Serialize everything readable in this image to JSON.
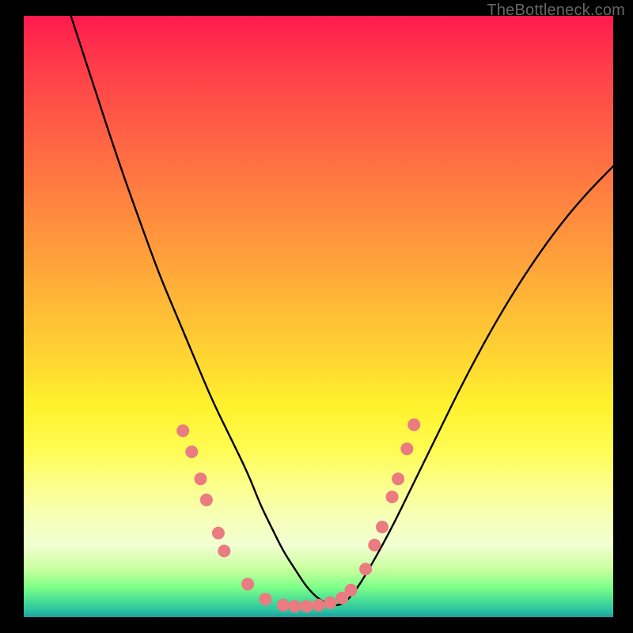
{
  "watermark": "TheBottleneck.com",
  "chart_data": {
    "type": "line",
    "title": "",
    "xlabel": "",
    "ylabel": "",
    "xlim": [
      0,
      100
    ],
    "ylim": [
      0,
      100
    ],
    "legend": false,
    "grid": false,
    "series": [
      {
        "name": "curve",
        "color": "#000000",
        "x": [
          8,
          12,
          16,
          20,
          23,
          26,
          29,
          32,
          35,
          38,
          40,
          42,
          44,
          46,
          48,
          50,
          52,
          54,
          56,
          58,
          62,
          66,
          70,
          75,
          80,
          85,
          90,
          95,
          100
        ],
        "y": [
          100,
          88,
          76,
          65,
          57,
          50,
          43,
          36,
          30,
          24,
          19,
          15,
          11,
          8,
          5,
          3,
          2,
          2,
          4,
          7,
          14,
          22,
          30,
          40,
          49,
          57,
          64,
          70,
          75
        ]
      }
    ],
    "markers": {
      "name": "dots",
      "color": "#e97b81",
      "radius": 8,
      "points": [
        {
          "x": 27,
          "y": 31
        },
        {
          "x": 28.5,
          "y": 27.5
        },
        {
          "x": 30,
          "y": 23
        },
        {
          "x": 31,
          "y": 19.5
        },
        {
          "x": 33,
          "y": 14
        },
        {
          "x": 34,
          "y": 11
        },
        {
          "x": 38,
          "y": 5.5
        },
        {
          "x": 41,
          "y": 3
        },
        {
          "x": 44,
          "y": 2
        },
        {
          "x": 46,
          "y": 1.8
        },
        {
          "x": 48,
          "y": 1.8
        },
        {
          "x": 50,
          "y": 2
        },
        {
          "x": 52,
          "y": 2.4
        },
        {
          "x": 54,
          "y": 3.2
        },
        {
          "x": 55.5,
          "y": 4.5
        },
        {
          "x": 58,
          "y": 8
        },
        {
          "x": 59.5,
          "y": 12
        },
        {
          "x": 60.8,
          "y": 15
        },
        {
          "x": 62.5,
          "y": 20
        },
        {
          "x": 63.5,
          "y": 23
        },
        {
          "x": 65,
          "y": 28
        },
        {
          "x": 66.2,
          "y": 32
        }
      ]
    }
  }
}
